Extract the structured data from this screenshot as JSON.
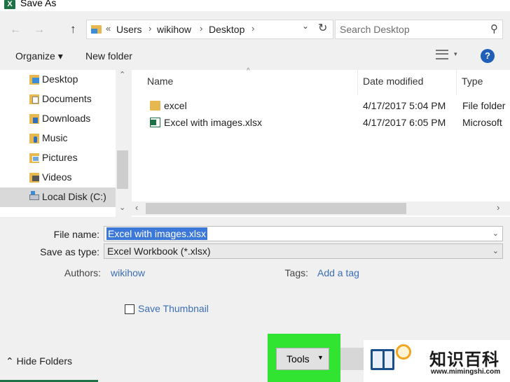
{
  "window": {
    "title": "Save As",
    "app_icon": "X"
  },
  "nav": {
    "back": "←",
    "forward": "→",
    "up": "↑"
  },
  "address": {
    "crumb_more": "«",
    "crumbs": [
      "Users",
      "wikihow",
      "Desktop"
    ],
    "dropdown": "⌄",
    "refresh": "↻"
  },
  "search": {
    "placeholder": "Search Desktop",
    "icon": "⚲"
  },
  "toolbar": {
    "organize": "Organize ▾",
    "new_folder": "New folder",
    "help": "?"
  },
  "sidebar": {
    "items": [
      {
        "label": "Desktop",
        "icon": "folder-desktop-icon"
      },
      {
        "label": "Documents",
        "icon": "folder-documents-icon"
      },
      {
        "label": "Downloads",
        "icon": "folder-downloads-icon"
      },
      {
        "label": "Music",
        "icon": "folder-music-icon"
      },
      {
        "label": "Pictures",
        "icon": "folder-pictures-icon"
      },
      {
        "label": "Videos",
        "icon": "folder-videos-icon"
      },
      {
        "label": "Local Disk (C:)",
        "icon": "drive-icon",
        "selected": true
      }
    ]
  },
  "files": {
    "columns": [
      "Name",
      "Date modified",
      "Type"
    ],
    "rows": [
      {
        "name": "excel",
        "date": "4/17/2017 5:04 PM",
        "type": "File folder",
        "icon": "folder-icon"
      },
      {
        "name": "Excel with images.xlsx",
        "date": "4/17/2017 6:05 PM",
        "type": "Microsoft",
        "icon": "excel-file-icon"
      }
    ]
  },
  "form": {
    "file_name_label": "File name:",
    "file_name_value": "Excel with images.xlsx",
    "save_type_label": "Save as type:",
    "save_type_value": "Excel Workbook (*.xlsx)",
    "authors_label": "Authors:",
    "authors_value": "wikihow",
    "tags_label": "Tags:",
    "tags_value": "Add a tag",
    "thumbnail_label": "Save Thumbnail"
  },
  "footer": {
    "hide_folders": "Hide Folders",
    "tools": "Tools"
  },
  "watermark": {
    "title": "知识百科",
    "url": "www.mimingshi.com"
  },
  "colors": {
    "highlight": "#31e431",
    "selection": "#3c78d8",
    "link": "#3c6eb4",
    "excel_green": "#1e7145"
  }
}
